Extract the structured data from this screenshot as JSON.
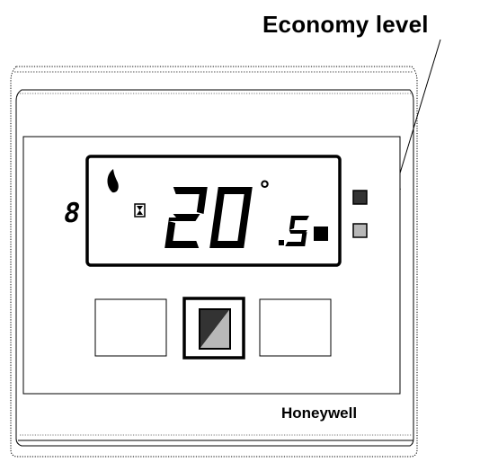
{
  "callout": {
    "label": "Economy level"
  },
  "device": {
    "brand": "Honeywell",
    "display": {
      "temperature_main": "20",
      "temperature_decimal": "5",
      "degree_symbol": "°",
      "program_digit": "8"
    },
    "indicators": [
      {
        "name": "comfort-level-indicator",
        "color": "#333333"
      },
      {
        "name": "economy-level-indicator",
        "color": "#b8b8b8"
      }
    ],
    "buttons": [
      {
        "name": "left-button"
      },
      {
        "name": "mode-button",
        "icon": "comfort-economy-toggle-icon"
      },
      {
        "name": "right-button"
      }
    ]
  },
  "colors": {
    "outline": "#000000",
    "frame": "#555555",
    "dark_indicator": "#333333",
    "light_indicator": "#b8b8b8",
    "background": "#ffffff"
  }
}
